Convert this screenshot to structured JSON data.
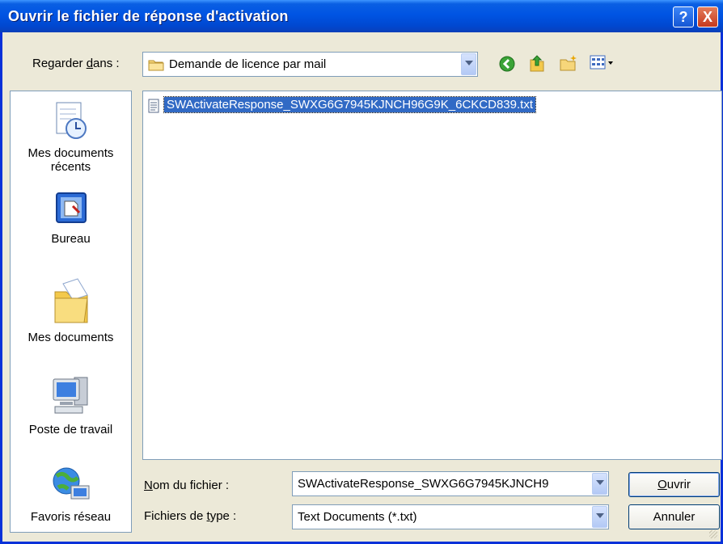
{
  "dialog": {
    "title": "Ouvrir le fichier de réponse d'activation",
    "help_label": "?",
    "close_label": "X"
  },
  "lookin": {
    "label_prefix": "Regarder ",
    "label_underlined": "d",
    "label_suffix": "ans :",
    "value": "Demande de licence par mail"
  },
  "places": [
    {
      "label_line1": "Mes documents",
      "label_line2": "récents",
      "icon": "recent-documents-icon"
    },
    {
      "label_line1": "Bureau",
      "label_line2": "",
      "icon": "desktop-icon"
    },
    {
      "label_line1": "Mes documents",
      "label_line2": "",
      "icon": "my-documents-icon"
    },
    {
      "label_line1": "Poste de travail",
      "label_line2": "",
      "icon": "my-computer-icon"
    },
    {
      "label_line1": "Favoris réseau",
      "label_line2": "",
      "icon": "network-places-icon"
    }
  ],
  "files": [
    {
      "name": "SWActivateResponse_SWXG6G7945KJNCH96G9K_6CKCD839.txt",
      "selected": true
    }
  ],
  "filename": {
    "label_underlined": "N",
    "label_rest": "om du fichier :",
    "value": "SWActivateResponse_SWXG6G7945KJNCH9"
  },
  "filetype": {
    "label_prefix": "Fichiers de ",
    "label_underlined": "t",
    "label_rest": "ype :",
    "value": "Text Documents (*.txt)"
  },
  "buttons": {
    "open_underlined": "O",
    "open_rest": "uvrir",
    "cancel": "Annuler"
  },
  "colors": {
    "titlebar": "#0054e3",
    "selection": "#316ac5",
    "dialog_bg": "#ece9d8"
  }
}
